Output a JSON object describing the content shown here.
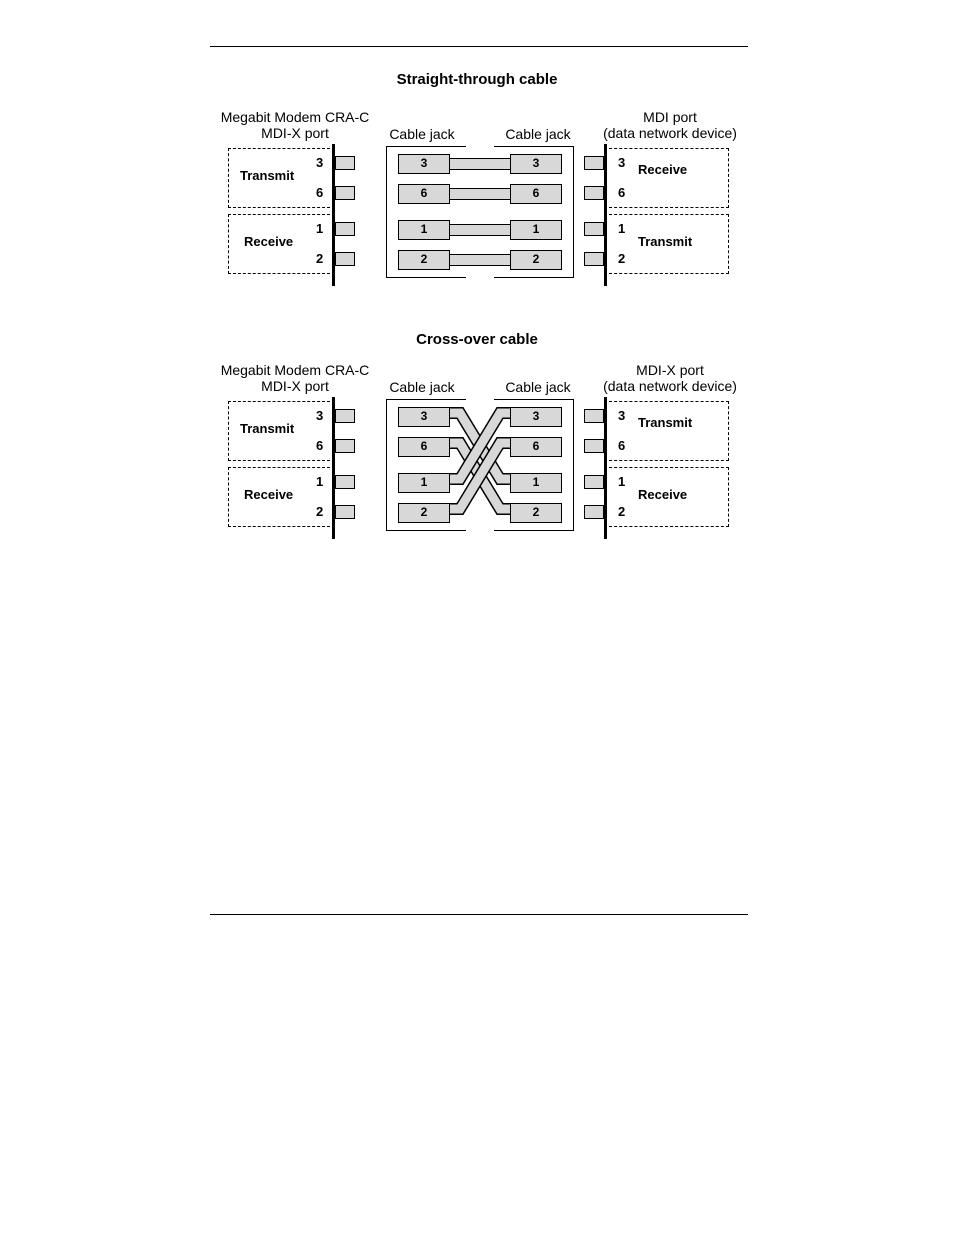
{
  "diagram1": {
    "title": "Straight-through cable",
    "left_port": {
      "label1": "Megabit Modem CRA-C",
      "label2": "MDI-X port",
      "tx": "Transmit",
      "rx": "Receive"
    },
    "right_port": {
      "label1": "MDI port",
      "label2": "(data network device)",
      "tx": "Transmit",
      "rx": "Receive"
    },
    "jack_label": "Cable jack",
    "pins": {
      "p3": "3",
      "p6": "6",
      "p1": "1",
      "p2": "2"
    }
  },
  "diagram2": {
    "title": "Cross-over cable",
    "left_port": {
      "label1": "Megabit Modem CRA-C",
      "label2": "MDI-X port",
      "tx": "Transmit",
      "rx": "Receive"
    },
    "right_port": {
      "label1": "MDI-X port",
      "label2": "(data network device)",
      "tx": "Transmit",
      "rx": "Receive"
    },
    "jack_label": "Cable jack",
    "pins": {
      "p3": "3",
      "p6": "6",
      "p1": "1",
      "p2": "2"
    }
  }
}
